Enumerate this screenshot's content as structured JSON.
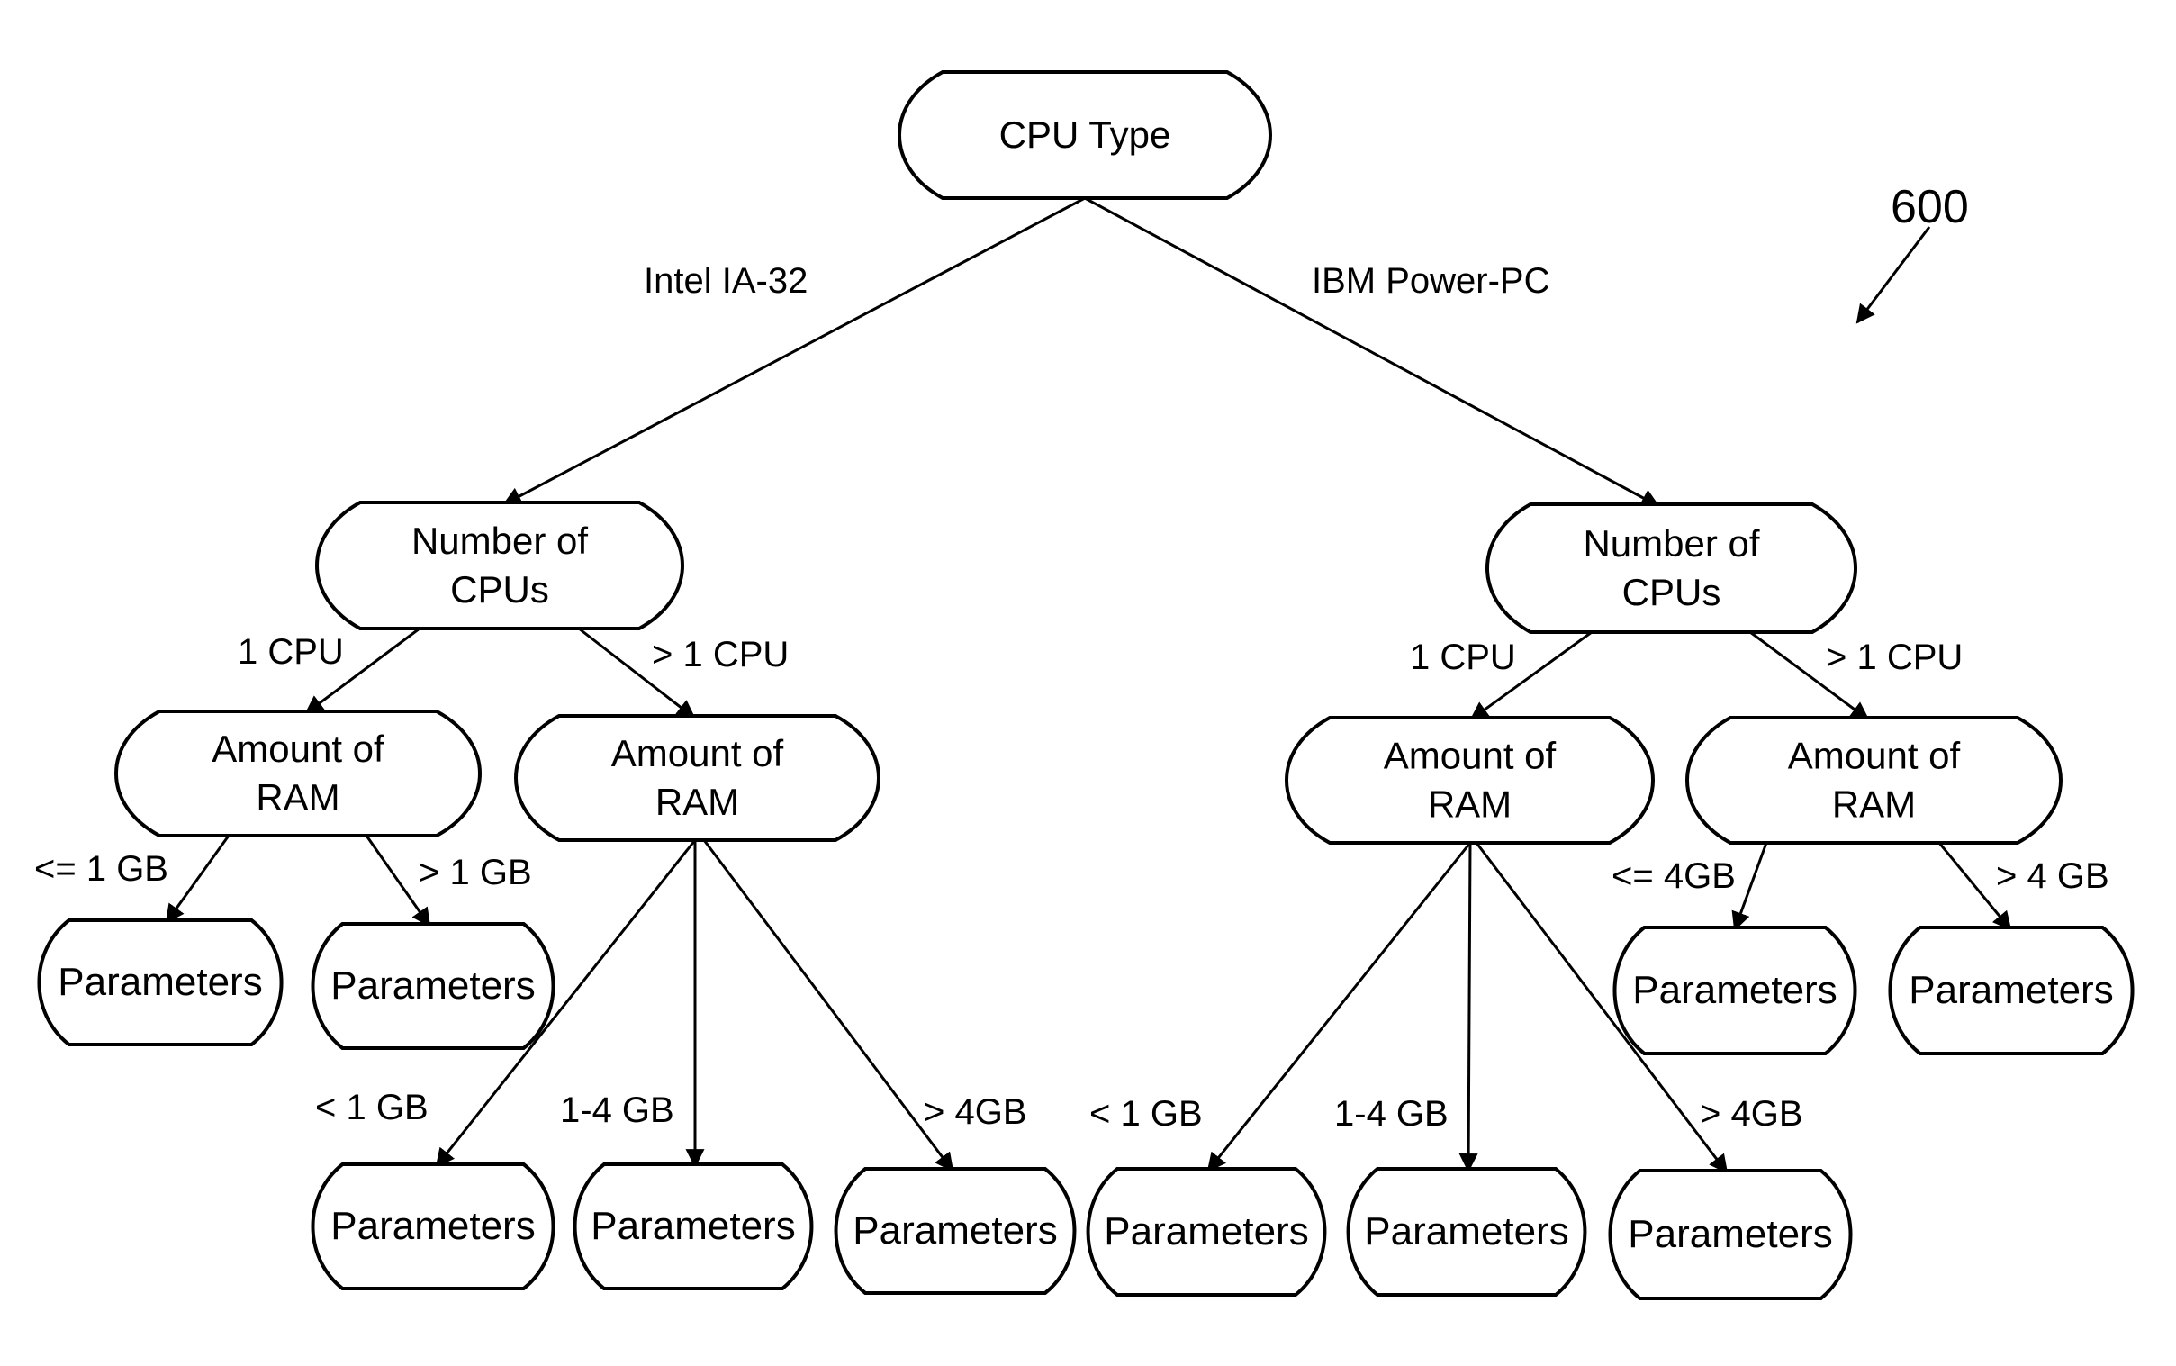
{
  "figure": {
    "reference_number": "600"
  },
  "nodes": {
    "root": {
      "label_lines": [
        "CPU Type"
      ]
    },
    "cpus_intel": {
      "label_lines": [
        "Number of",
        "CPUs"
      ]
    },
    "cpus_ibm": {
      "label_lines": [
        "Number of",
        "CPUs"
      ]
    },
    "ram_intel_1cpu": {
      "label_lines": [
        "Amount of",
        "RAM"
      ]
    },
    "ram_intel_multi": {
      "label_lines": [
        "Amount of",
        "RAM"
      ]
    },
    "ram_ibm_1cpu": {
      "label_lines": [
        "Amount of",
        "RAM"
      ]
    },
    "ram_ibm_multi": {
      "label_lines": [
        "Amount of",
        "RAM"
      ]
    },
    "p_intel_1cpu_le1": {
      "label_lines": [
        "Parameters"
      ]
    },
    "p_intel_1cpu_gt1": {
      "label_lines": [
        "Parameters"
      ]
    },
    "p_intel_multi_lt1": {
      "label_lines": [
        "Parameters"
      ]
    },
    "p_intel_multi_1to4": {
      "label_lines": [
        "Parameters"
      ]
    },
    "p_intel_multi_gt4": {
      "label_lines": [
        "Parameters"
      ]
    },
    "p_ibm_1cpu_lt1": {
      "label_lines": [
        "Parameters"
      ]
    },
    "p_ibm_1cpu_1to4": {
      "label_lines": [
        "Parameters"
      ]
    },
    "p_ibm_1cpu_gt4": {
      "label_lines": [
        "Parameters"
      ]
    },
    "p_ibm_multi_le4": {
      "label_lines": [
        "Parameters"
      ]
    },
    "p_ibm_multi_gt4": {
      "label_lines": [
        "Parameters"
      ]
    }
  },
  "edges": [
    {
      "from": "root",
      "to": "cpus_intel",
      "label": "Intel IA-32"
    },
    {
      "from": "root",
      "to": "cpus_ibm",
      "label": "IBM Power-PC"
    },
    {
      "from": "cpus_intel",
      "to": "ram_intel_1cpu",
      "label": "1 CPU"
    },
    {
      "from": "cpus_intel",
      "to": "ram_intel_multi",
      "label": "> 1 CPU"
    },
    {
      "from": "cpus_ibm",
      "to": "ram_ibm_1cpu",
      "label": "1 CPU"
    },
    {
      "from": "cpus_ibm",
      "to": "ram_ibm_multi",
      "label": "> 1 CPU"
    },
    {
      "from": "ram_intel_1cpu",
      "to": "p_intel_1cpu_le1",
      "label": "<= 1 GB"
    },
    {
      "from": "ram_intel_1cpu",
      "to": "p_intel_1cpu_gt1",
      "label": "> 1 GB"
    },
    {
      "from": "ram_intel_multi",
      "to": "p_intel_multi_lt1",
      "label": "< 1 GB"
    },
    {
      "from": "ram_intel_multi",
      "to": "p_intel_multi_1to4",
      "label": "1-4 GB"
    },
    {
      "from": "ram_intel_multi",
      "to": "p_intel_multi_gt4",
      "label": "> 4GB"
    },
    {
      "from": "ram_ibm_1cpu",
      "to": "p_ibm_1cpu_lt1",
      "label": "< 1 GB"
    },
    {
      "from": "ram_ibm_1cpu",
      "to": "p_ibm_1cpu_1to4",
      "label": "1-4 GB"
    },
    {
      "from": "ram_ibm_1cpu",
      "to": "p_ibm_1cpu_gt4",
      "label": "> 4GB"
    },
    {
      "from": "ram_ibm_multi",
      "to": "p_ibm_multi_le4",
      "label": "<= 4GB"
    },
    {
      "from": "ram_ibm_multi",
      "to": "p_ibm_multi_gt4",
      "label": "> 4 GB"
    }
  ]
}
